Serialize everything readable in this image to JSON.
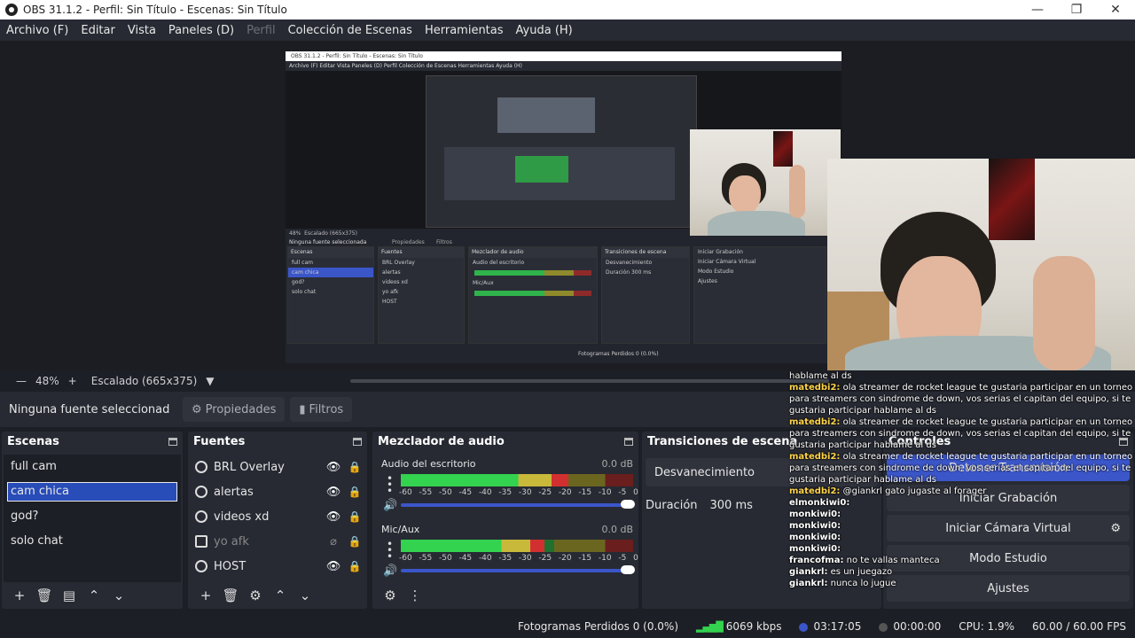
{
  "window": {
    "title": "OBS 31.1.2 - Perfil: Sin Título - Escenas: Sin Título"
  },
  "menu": [
    "Archivo (F)",
    "Editar",
    "Vista",
    "Paneles (D)",
    "Perfil",
    "Colección de Escenas",
    "Herramientas",
    "Ayuda (H)"
  ],
  "nested": {
    "title": "OBS 31.1.2 - Perfil: Sin Título - Escenas: Sin Título",
    "menu": "Archivo (F)   Editar   Vista   Paneles (D)   Perfil   Colección de Escenas   Herramientas   Ayuda (H)",
    "zoom": "48%",
    "scale": "Escalado (665x375)",
    "nosrc": "Ninguna fuente seleccionada",
    "props": "Propiedades",
    "filters": "Filtros",
    "scenes_h": "Escenas",
    "sources_h": "Fuentes",
    "mixer_h": "Mezclador de audio",
    "trans_h": "Transiciones de escena",
    "scenes": [
      "full cam",
      "cam chica",
      "god?",
      "solo chat"
    ],
    "sources": [
      "BRL Overlay",
      "alertas",
      "videos xd",
      "yo afk",
      "HOST"
    ],
    "mix1": "Audio del escritorio",
    "mix2": "Mic/Aux",
    "trans": "Desvanecimiento",
    "dur_l": "Duración",
    "dur": "300 ms",
    "ctl": [
      "Iniciar Grabación",
      "Iniciar Cámara Virtual",
      "Modo Estudio",
      "Ajustes"
    ],
    "status": "Fotogramas Perdidos 0 (0.0%)"
  },
  "zoombar": {
    "zoom": "48%",
    "plus": "+",
    "scale": "Escalado (665x375)"
  },
  "source_toolbar": {
    "no_source": "Ninguna fuente seleccionad",
    "properties": "Propiedades",
    "filters": "Filtros"
  },
  "scenes": {
    "title": "Escenas",
    "items": [
      "full cam",
      "cam chica",
      "god?",
      "solo chat"
    ],
    "selected": 1
  },
  "sources": {
    "title": "Fuentes",
    "items": [
      {
        "name": "BRL Overlay",
        "icon": "globe-icon",
        "visible": true
      },
      {
        "name": "alertas",
        "icon": "globe-icon",
        "visible": true
      },
      {
        "name": "videos xd",
        "icon": "globe-icon",
        "visible": true
      },
      {
        "name": "yo afk",
        "icon": "image-icon",
        "visible": false
      },
      {
        "name": "HOST",
        "icon": "globe-icon",
        "visible": true
      }
    ]
  },
  "mixer": {
    "title": "Mezclador de audio",
    "channels": [
      {
        "name": "Audio del escritorio",
        "db": "0.0 dB",
        "level": 0.72
      },
      {
        "name": "Mic/Aux",
        "db": "0.0 dB",
        "level": 0.62
      }
    ],
    "ticks": [
      "-60",
      "-55",
      "-50",
      "-45",
      "-40",
      "-35",
      "-30",
      "-25",
      "-20",
      "-15",
      "-10",
      "-5",
      "0"
    ]
  },
  "transitions": {
    "title": "Transiciones de escena",
    "selected": "Desvanecimiento",
    "duration_label": "Duración",
    "duration": "300 ms"
  },
  "controls": {
    "title": "Controles",
    "stop_stream": "Detener Transmisión",
    "record": "Iniciar Grabación",
    "virtual_cam": "Iniciar Cámara Virtual",
    "studio": "Modo Estudio",
    "settings": "Ajustes"
  },
  "chat": [
    {
      "user": "",
      "msg": "hablame al ds"
    },
    {
      "user": "matedbi2:",
      "msg": "ola streamer de rocket league te gustaria participar en un torneo para streamers con sindrome de down, vos serias el capitan del equipo, si te gustaria participar hablame al ds"
    },
    {
      "user": "matedbi2:",
      "msg": "ola streamer de rocket league te gustaria participar en un torneo para streamers con sindrome de down, vos serias el capitan del equipo, si te gustaria participar hablame al ds"
    },
    {
      "user": "matedbi2:",
      "msg": "ola streamer de rocket league te gustaria participar en un torneo para streamers con sindrome de down, vos serias el capitan del equipo, si te gustaria participar hablame al ds"
    },
    {
      "user": "matedbi2:",
      "msg": "@giankrl gato jugaste al forager"
    },
    {
      "user": "elmonkiwi0:",
      "msg": ""
    },
    {
      "user": "monkiwi0:",
      "msg": ""
    },
    {
      "user": "monkiwi0:",
      "msg": ""
    },
    {
      "user": "monkiwi0:",
      "msg": ""
    },
    {
      "user": "monkiwi0:",
      "msg": ""
    },
    {
      "user": "francofma:",
      "msg": "no te vallas manteca"
    },
    {
      "user": "giankrl:",
      "msg": "es un juegazo"
    },
    {
      "user": "giankrl:",
      "msg": "nunca lo jugue"
    }
  ],
  "status": {
    "dropped": "Fotogramas Perdidos 0 (0.0%)",
    "kbps": "6069 kbps",
    "live_time": "03:17:05",
    "rec_time": "00:00:00",
    "cpu": "CPU: 1.9%",
    "fps": "60.00 / 60.00 FPS"
  },
  "colors": {
    "accent": "#3b56c9",
    "selected_scene": "#284cb8",
    "panel": "#272a33",
    "background": "#1d1f26"
  }
}
